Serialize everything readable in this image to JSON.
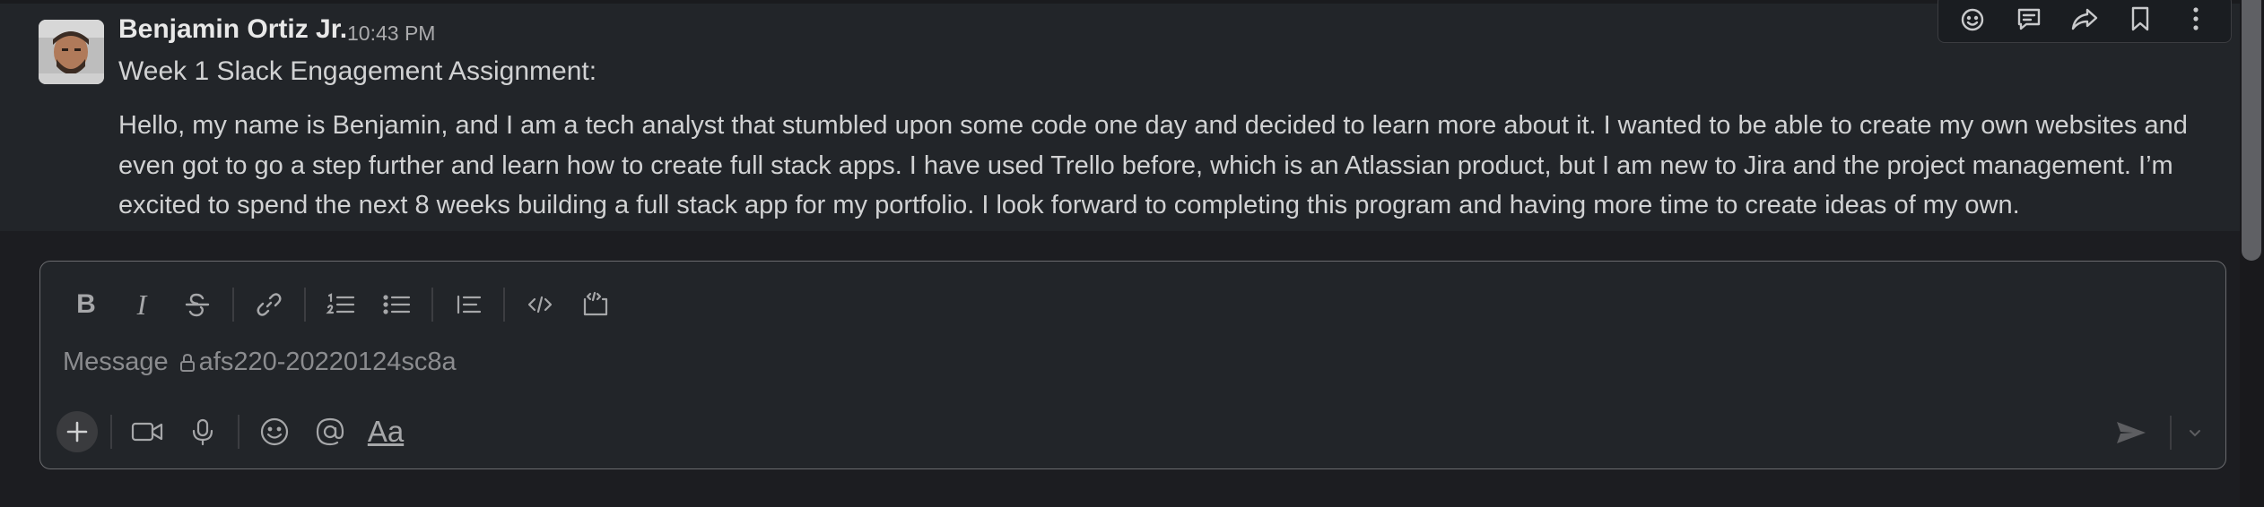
{
  "message": {
    "sender": "Benjamin Ortiz Jr.",
    "timestamp": "10:43 PM",
    "title_line": "Week 1 Slack Engagement Assignment:",
    "body": "Hello, my name is Benjamin, and I am a tech analyst that stumbled upon some code one day and decided to learn more about it. I wanted to be able to create my own websites and even got to go a step further and learn how to create full stack apps. I have used Trello before, which is an Atlassian product, but I am new to Jira and the project management. I’m excited to spend the next 8 weeks building a full stack app for my portfolio. I look forward to completing this program and having more time to create ideas of my own."
  },
  "hover_actions": [
    "add-reaction-icon",
    "reply-in-thread-icon",
    "share-icon",
    "save-bookmark-icon",
    "more-actions-icon"
  ],
  "composer": {
    "formatting": {
      "bold_label": "B",
      "italic_label": "I"
    },
    "placeholder_prefix": "Message",
    "channel_name": "afs220-20220124sc8a",
    "text_format_label": "Aa"
  },
  "colors": {
    "background": "#1c1d21",
    "message_bg": "#222529",
    "text": "#d1d2d3",
    "muted": "#ababad"
  }
}
